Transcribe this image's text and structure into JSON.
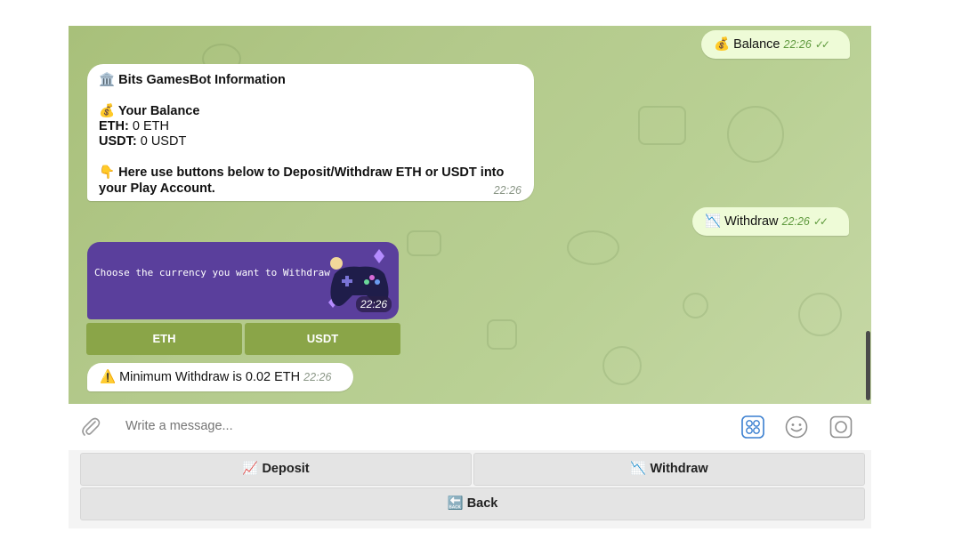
{
  "chat": {
    "outgoing": [
      {
        "emoji": "💰",
        "text": "Balance",
        "time": "22:26"
      },
      {
        "emoji": "📉",
        "text": "Withdraw",
        "time": "22:26"
      }
    ],
    "info_message": {
      "title_emoji": "🏛️",
      "title": "Bits GamesBot Information",
      "balance_emoji": "💰",
      "balance_heading": "Your Balance",
      "eth_label": "ETH:",
      "eth_value": "0 ETH",
      "usdt_label": "USDT:",
      "usdt_value": "0 USDT",
      "hint_emoji": "👇",
      "hint_line1": "Here use buttons below to Deposit/Withdraw ETH or USDT into",
      "hint_line2": "your Play Account.",
      "time": "22:26"
    },
    "currency_card": {
      "caption": "Choose the currency you want to Withdraw",
      "time": "22:26"
    },
    "inline_buttons": [
      "ETH",
      "USDT"
    ],
    "warning_message": {
      "emoji": "⚠️",
      "text": "Minimum Withdraw is 0.02 ETH",
      "time": "22:26"
    }
  },
  "composer": {
    "placeholder": "Write a message..."
  },
  "keyboard": {
    "deposit": {
      "emoji": "📈",
      "label": "Deposit"
    },
    "withdraw": {
      "emoji": "📉",
      "label": "Withdraw"
    },
    "back": {
      "emoji": "🔙",
      "label": "Back"
    }
  },
  "colors": {
    "chat_bg": "#b3c98b",
    "outgoing_bubble": "#eefbd7",
    "card_bg": "#5a3f9c",
    "inline_button": "#8aa548"
  }
}
